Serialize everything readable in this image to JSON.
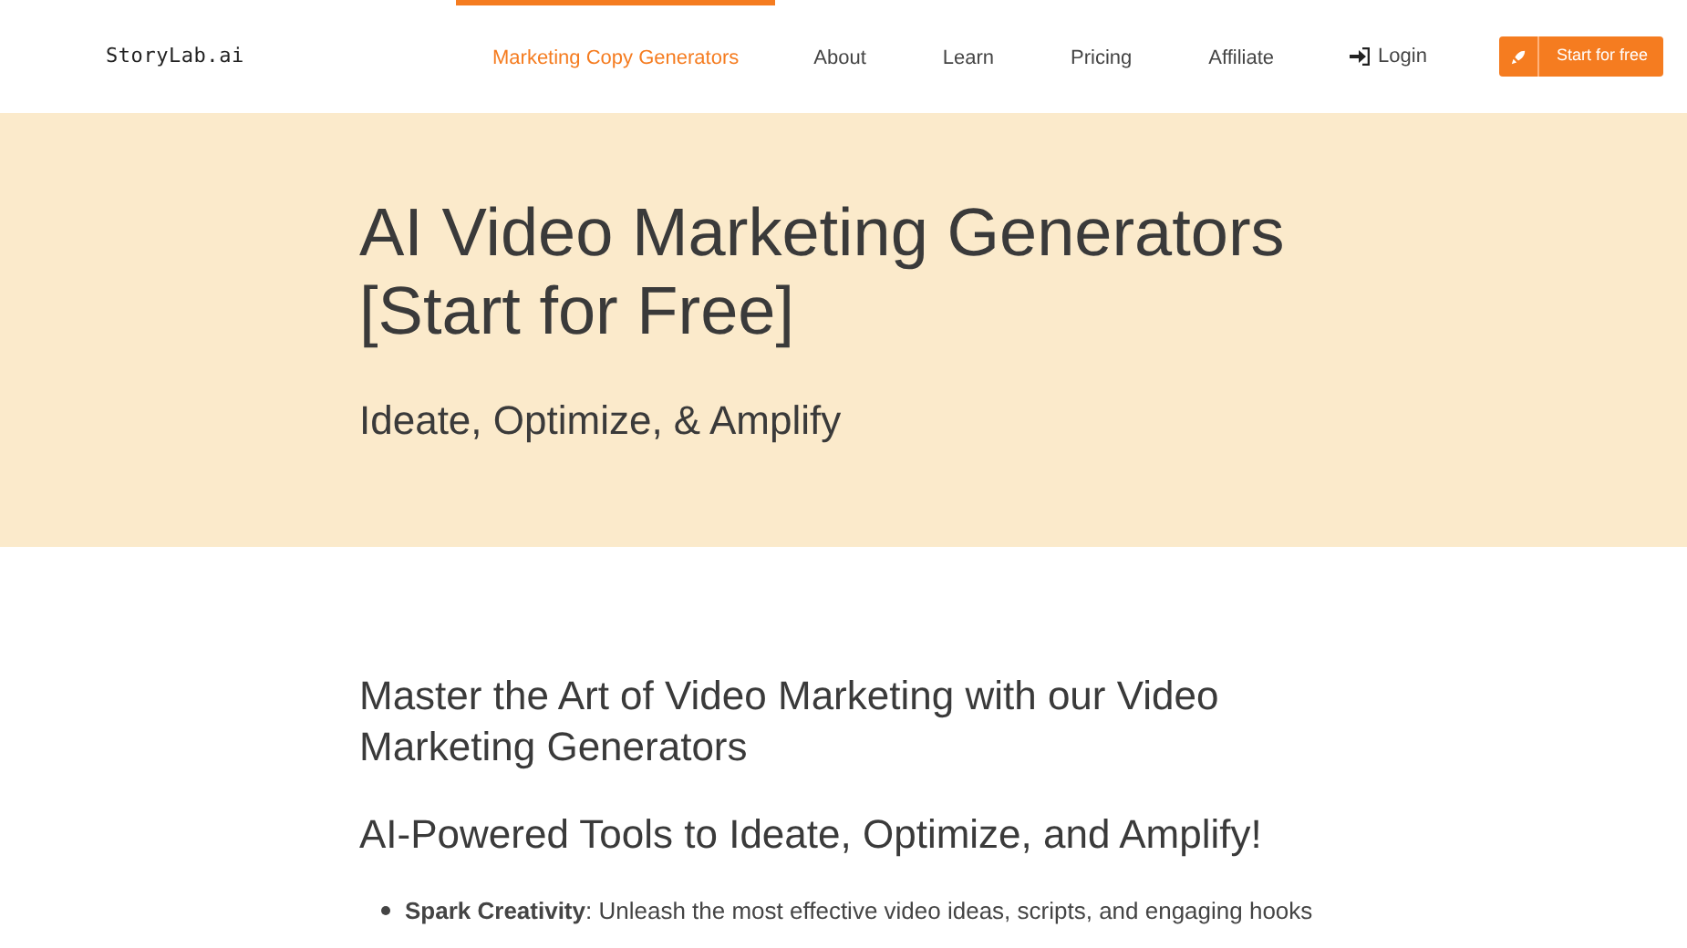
{
  "header": {
    "logo": "StoryLab.ai",
    "nav": [
      {
        "label": "Marketing Copy Generators",
        "selected": true
      },
      {
        "label": "About",
        "selected": false
      },
      {
        "label": "Learn",
        "selected": false
      },
      {
        "label": "Pricing",
        "selected": false
      },
      {
        "label": "Affiliate",
        "selected": false
      }
    ],
    "login": "Login",
    "cta": "Start for free"
  },
  "hero": {
    "title": "AI Video Marketing Generators [Start for Free]",
    "subtitle": "Ideate, Optimize, & Amplify"
  },
  "content": {
    "heading": "Master the Art of Video Marketing with our Video Marketing Generators",
    "subheading": "AI-Powered Tools to Ideate, Optimize, and Amplify!",
    "bullets": [
      "**Spark Creativity**: Unleash the most effective video ideas, scripts, and engaging hooks"
    ]
  }
}
